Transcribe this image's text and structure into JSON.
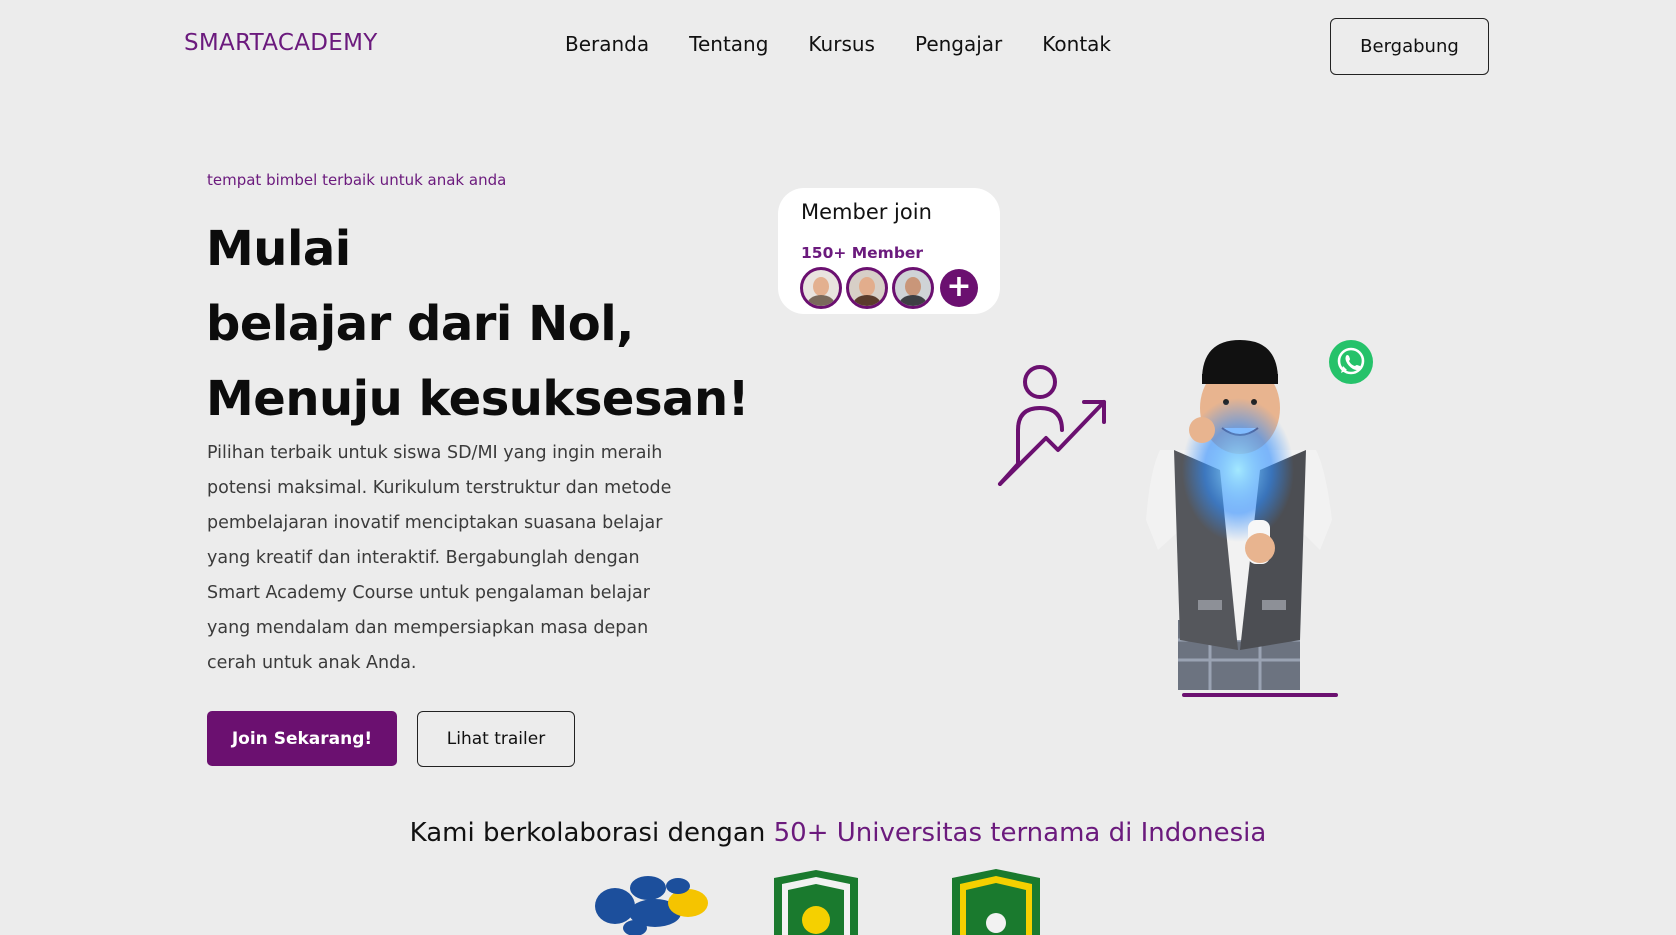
{
  "brand": "SMARTACADEMY",
  "nav": {
    "items": [
      "Beranda",
      "Tentang",
      "Kursus",
      "Pengajar",
      "Kontak"
    ],
    "cta": "Bergabung"
  },
  "hero": {
    "tagline": "tempat bimbel terbaik untuk anak anda",
    "headline": [
      "Mulai",
      "belajar dari Nol,",
      "Menuju kesuksesan!"
    ],
    "description": "Pilihan terbaik untuk siswa SD/MI yang ingin meraih potensi maksimal. Kurikulum terstruktur dan metode pembelajaran inovatif menciptakan suasana belajar yang kreatif dan interaktif. Bergabunglah dengan Smart Academy Course untuk pengalaman belajar yang mendalam dan mempersiapkan masa depan cerah untuk anak Anda.",
    "primary_button": "Join Sekarang!",
    "secondary_button": "Lihat trailer"
  },
  "member_card": {
    "title": "Member join",
    "count": "150+ Member",
    "plus_symbol": "+"
  },
  "collaboration": {
    "prefix": "Kami berkolaborasi dengan ",
    "highlight": "50+ Universitas ternama di Indonesia"
  },
  "colors": {
    "brand": "#6b1a7d",
    "primary_button": "#6b1070",
    "background": "#ececec",
    "whatsapp": "#25c26a"
  },
  "icons": [
    "growth-person-icon",
    "whatsapp-icon",
    "plus-icon"
  ]
}
